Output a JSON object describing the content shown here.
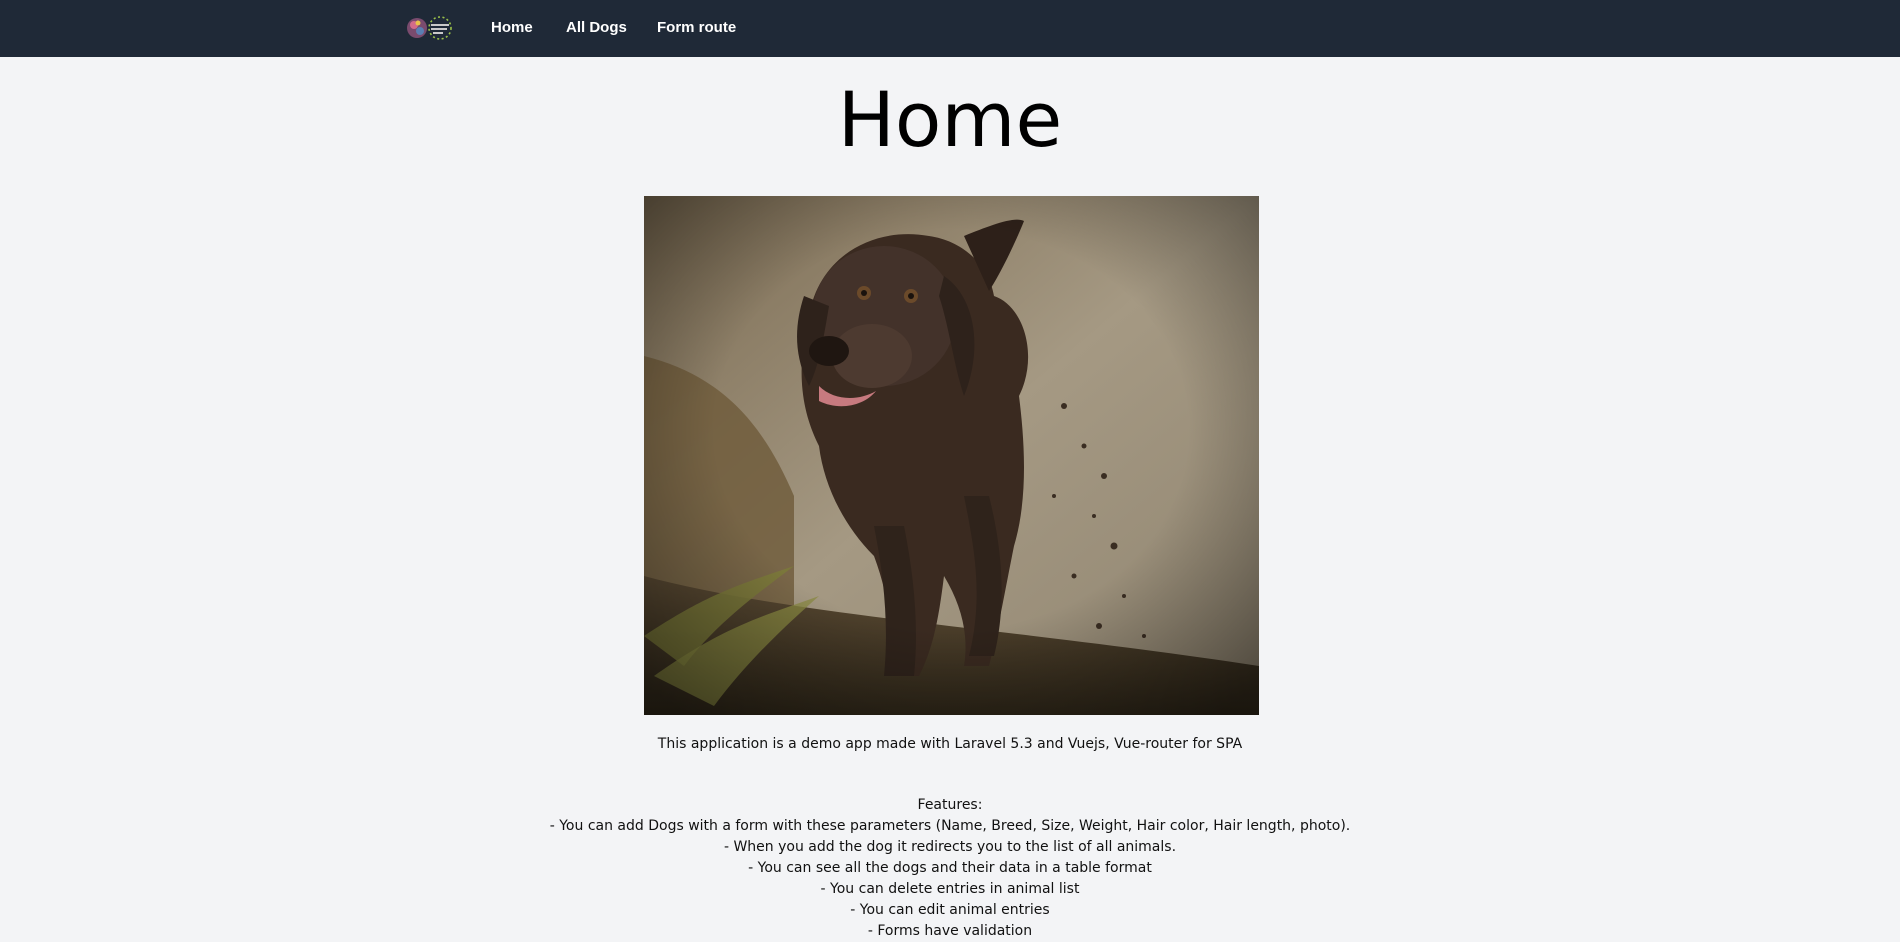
{
  "nav": {
    "logo_icon": "site-logo-icon",
    "links": [
      {
        "label": "Home"
      },
      {
        "label": "All Dogs"
      },
      {
        "label": "Form route"
      }
    ]
  },
  "main": {
    "title": "Home",
    "hero_image": {
      "subject": "dog-photo"
    },
    "description": "This application is a demo app made with Laravel 5.3 and Vuejs, Vue-router for SPA",
    "features_heading": "Features:",
    "features": [
      "- You can add Dogs with a form with these parameters (Name, Breed, Size, Weight, Hair color, Hair length, photo).",
      "- When you add the dog it redirects you to the list of all animals.",
      "- You can see all the dogs and their data in a table format",
      "- You can delete entries in animal list",
      "- You can edit animal entries",
      "- Forms have validation"
    ]
  },
  "colors": {
    "navbar": "#1f2937",
    "background": "#f3f4f6",
    "nav_text": "#ffffff"
  }
}
